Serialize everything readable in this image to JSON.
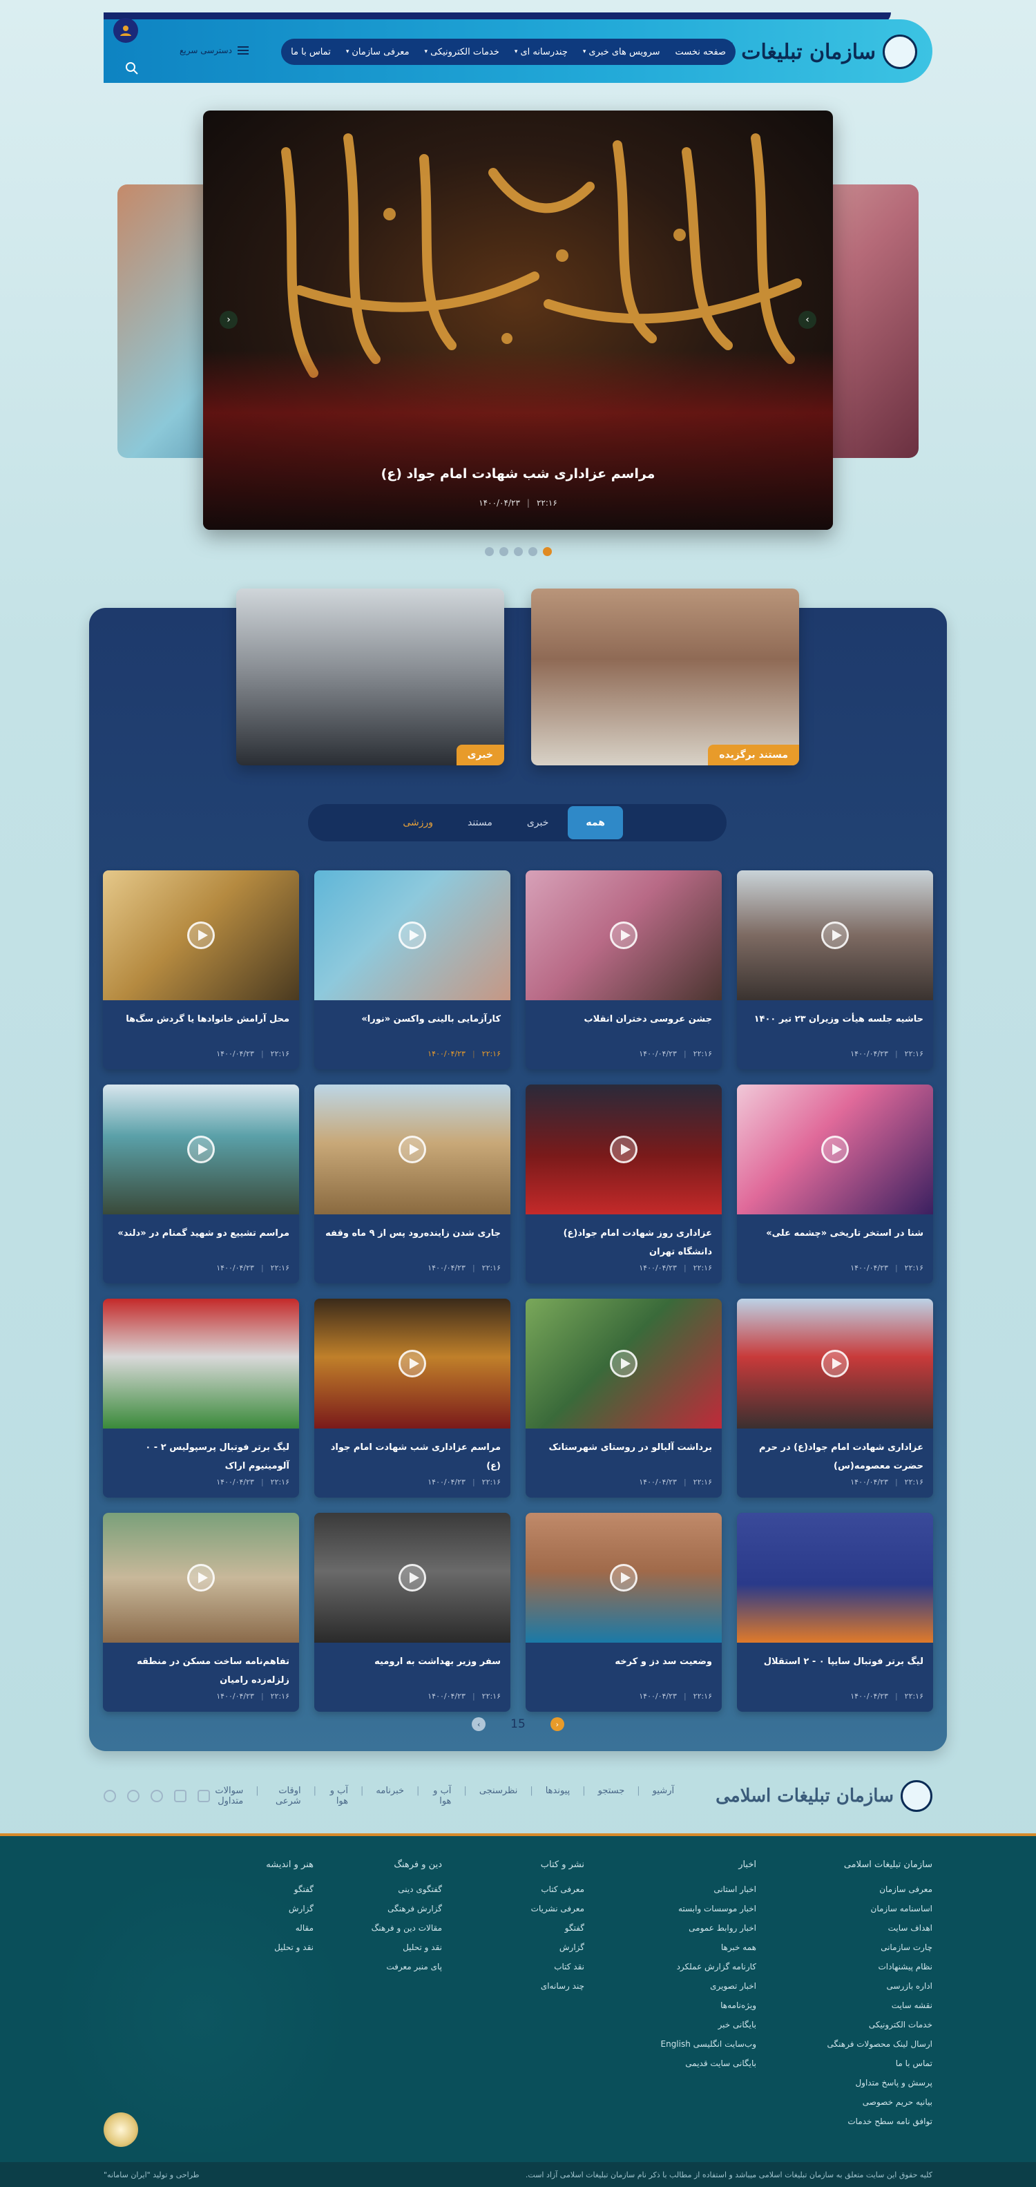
{
  "header": {
    "logo_text": "سازمان تبلیغات اسلامی",
    "quick_access": "دسترسی سریع",
    "nav": [
      {
        "label": "صفحه نخست",
        "dropdown": false
      },
      {
        "label": "سرویس های خبری",
        "dropdown": true
      },
      {
        "label": "چندرسانه ای",
        "dropdown": true
      },
      {
        "label": "خدمات الکترونیکی",
        "dropdown": true
      },
      {
        "label": "معرفی سازمان",
        "dropdown": true
      },
      {
        "label": "تماس با ما",
        "dropdown": false
      }
    ]
  },
  "hero": {
    "caption": "مراسم عزاداری شب شهادت امام جواد (ع)",
    "time": "۲۲:۱۶",
    "date": "۱۴۰۰/۰۴/۲۳",
    "slide_count": 5,
    "active_slide": 5
  },
  "features": [
    {
      "tag": "مستند برگزیده"
    },
    {
      "tag": "خبری"
    }
  ],
  "tabs": [
    {
      "label": "همه",
      "active": true
    },
    {
      "label": "خبری",
      "active": false
    },
    {
      "label": "مستند",
      "active": false
    },
    {
      "label": "ورزشی",
      "active": false
    }
  ],
  "cards": [
    {
      "title": "حاشیه جلسه هیأت وزیران ۲۳ تیر ۱۴۰۰",
      "time": "۲۲:۱۶",
      "date": "۱۴۰۰/۰۴/۲۳",
      "play": true,
      "highlight": false,
      "img": "linear-gradient(180deg,#c9d3d8 0%,#7d6a62 50%,#3a3330 100%)"
    },
    {
      "title": "جشن عروسی دختران انقلاب",
      "time": "۲۲:۱۶",
      "date": "۱۴۰۰/۰۴/۲۳",
      "play": true,
      "highlight": false,
      "img": "linear-gradient(135deg,#d7a1b8 0%,#b86a86 45%,#4a3530 100%)"
    },
    {
      "title": "کارآزمایی بالینی واکسن «نورا»",
      "time": "۲۲:۱۶",
      "date": "۱۴۰۰/۰۴/۲۳",
      "play": true,
      "highlight": true,
      "img": "linear-gradient(135deg,#5fb6d8 0%,#8ec9dc 40%,#c69784 100%)"
    },
    {
      "title": "محل آرامش خانوادها یا گردش سگ‌ها",
      "time": "۲۲:۱۶",
      "date": "۱۴۰۰/۰۴/۲۳",
      "play": true,
      "highlight": false,
      "img": "linear-gradient(135deg,#e5c88a 0%,#b58a40 45%,#4a3a20 100%)"
    },
    {
      "title": "شنا در استخر تاریخی «چشمه علی»",
      "time": "۲۲:۱۶",
      "date": "۱۴۰۰/۰۴/۲۳",
      "play": true,
      "highlight": false,
      "img": "linear-gradient(135deg,#f0c8d8 0%,#e06a9a 40%,#3a2060 100%)"
    },
    {
      "title": "عزاداری روز شهادت امام جواد(ع) دانشگاه تهران",
      "time": "۲۲:۱۶",
      "date": "۱۴۰۰/۰۴/۲۳",
      "play": true,
      "highlight": false,
      "img": "linear-gradient(180deg,#2a2a3a 0%,#7a1a1a 55%,#c42a2a 100%)"
    },
    {
      "title": "جاری شدن زاینده‌رود پس از ۹ ماه وقفه",
      "time": "۲۲:۱۶",
      "date": "۱۴۰۰/۰۴/۲۳",
      "play": true,
      "highlight": false,
      "img": "linear-gradient(180deg,#bcd6e6 0%,#c8a878 45%,#8a6a40 100%)"
    },
    {
      "title": "مراسم تشییع دو شهید گمنام در «دلند»",
      "time": "۲۲:۱۶",
      "date": "۱۴۰۰/۰۴/۲۳",
      "play": true,
      "highlight": false,
      "img": "linear-gradient(180deg,#d8e6ee 0%,#5aa0a8 40%,#3a4a3a 100%)"
    },
    {
      "title": "عزاداری شهادت امام جواد(ع) در حرم حضرت معصومه(س)",
      "time": "۲۲:۱۶",
      "date": "۱۴۰۰/۰۴/۲۳",
      "play": true,
      "highlight": false,
      "img": "linear-gradient(180deg,#bcd2e6 0%,#c83a3a 45%,#3a3030 100%)"
    },
    {
      "title": "برداشت آلبالو در روستای شهرستانک",
      "time": "۲۲:۱۶",
      "date": "۱۴۰۰/۰۴/۲۳",
      "play": true,
      "highlight": false,
      "img": "linear-gradient(135deg,#7aa85a 0%,#3a6a3a 45%,#c02a3a 100%)"
    },
    {
      "title": "مراسم عزاداری شب شهادت امام جواد (ع)",
      "time": "۲۲:۱۶",
      "date": "۱۴۰۰/۰۴/۲۳",
      "play": true,
      "highlight": false,
      "img": "linear-gradient(180deg,#3a2a1a 0%,#c0802a 45%,#7a1a1a 100%)"
    },
    {
      "title": "لیگ برتر فوتبال پرسپولیس ۲ - ۰ آلومینیوم اراک",
      "time": "۲۲:۱۶",
      "date": "۱۴۰۰/۰۴/۲۳",
      "play": false,
      "highlight": false,
      "img": "linear-gradient(180deg,#c42a2a 0%,#d8d8d8 45%,#3a8a3a 100%)"
    },
    {
      "title": "لیگ برتر فوتبال سایپا ۰ - ۲ استقلال",
      "time": "۲۲:۱۶",
      "date": "۱۴۰۰/۰۴/۲۳",
      "play": false,
      "highlight": false,
      "img": "linear-gradient(180deg,#3a4a9a 0%,#2a3a8a 55%,#e07a2a 100%)"
    },
    {
      "title": "وضعیت سد دز و کرخه",
      "time": "۲۲:۱۶",
      "date": "۱۴۰۰/۰۴/۲۳",
      "play": true,
      "highlight": false,
      "img": "linear-gradient(180deg,#c08a6a 0%,#a06a4a 45%,#1a7aa8 100%)"
    },
    {
      "title": "سفر وزیر بهداشت به ارومیه",
      "time": "۲۲:۱۶",
      "date": "۱۴۰۰/۰۴/۲۳",
      "play": true,
      "highlight": false,
      "img": "linear-gradient(180deg,#3a3a3a 0%,#6a6a6a 45%,#2a2a2a 100%)"
    },
    {
      "title": "تفاهم‌نامه ساخت مسکن در منطقه زلزله‌زده رامیان",
      "time": "۲۲:۱۶",
      "date": "۱۴۰۰/۰۴/۲۳",
      "play": true,
      "highlight": false,
      "img": "linear-gradient(180deg,#7aa07a 0%,#c8b89a 50%,#8a6a4a 100%)"
    }
  ],
  "pager": {
    "current": "15"
  },
  "footer_bar": {
    "logo_text": "سازمان تبلیغات اسلامی",
    "links": [
      "آرشیو",
      "جستجو",
      "پیوندها",
      "نظرسنجی",
      "آب و هوا",
      "خبرنامه",
      "آب و هوا",
      "اوقات شرعی",
      "سوالات متداول"
    ]
  },
  "footer_cols": [
    {
      "title": "سازمان تبلیغات اسلامی",
      "items": [
        "معرفی سازمان",
        "اساسنامه سازمان",
        "اهداف سایت",
        "چارت سازمانی",
        "نظام پیشنهادات",
        "اداره بازرسی",
        "نقشه سایت",
        "خدمات الکترونیکی",
        "ارسال لینک محصولات فرهنگی",
        "تماس با ما",
        "پرسش و پاسخ متداول",
        "بیانیه حریم خصوصی",
        "توافق نامه سطح خدمات"
      ]
    },
    {
      "title": "اخبار",
      "items": [
        "اخبار استانی",
        "اخبار موسسات وابسته",
        "اخبار روابط عمومی",
        "همه خبرها",
        "کارنامه گزارش عملکرد",
        "اخبار تصویری",
        "ویژه‌نامه‌ها",
        "بایگانی خبر",
        "وب‌سایت انگلیسی English",
        "بایگانی سایت قدیمی"
      ]
    },
    {
      "title": "نشر و کتاب",
      "items": [
        "معرفی کتاب",
        "معرفی نشریات",
        "گفتگو",
        "گزارش",
        "نقد کتاب",
        "چند رسانه‌ای"
      ]
    },
    {
      "title": "دین و فرهنگ",
      "items": [
        "گفتگوی دینی",
        "گزارش فرهنگی",
        "مقالات دین و فرهنگ",
        "نقد و تحلیل",
        "پای منبر معرفت"
      ]
    },
    {
      "title": "هنر و اندیشه",
      "items": [
        "گفتگو",
        "گزارش",
        "مقاله",
        "نقد و تحلیل"
      ]
    }
  ],
  "copyright": {
    "right": "کلیه حقوق این سایت متعلق به سازمان تبلیغات اسلامی میباشد و استفاده از مطالب با ذکر نام سازمان تبلیغات اسلامی آزاد است.",
    "left": "طراحی و تولید \"ایران سامانه\""
  },
  "colors": {
    "accent": "#e89b2a",
    "nav_bg": "#0e3a7e",
    "panel": "#1e3a6c",
    "footer": "#0a4f5a"
  }
}
